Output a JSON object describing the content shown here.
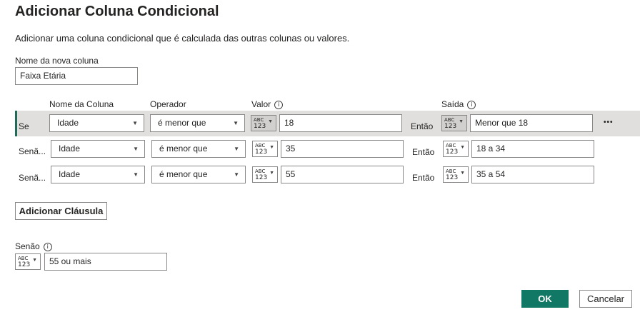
{
  "dialog": {
    "title": "Adicionar Coluna Condicional",
    "description": "Adicionar uma coluna condicional que é calculada das outras colunas ou valores."
  },
  "new_column": {
    "label": "Nome da nova coluna",
    "value": "Faixa Etária"
  },
  "headers": {
    "column_name": "Nome da Coluna",
    "operator": "Operador",
    "value": "Valor",
    "output": "Saída",
    "info_glyph": "i"
  },
  "type_selector": {
    "top": "ABC",
    "bottom": "123",
    "chevron": "▼"
  },
  "rules": [
    {
      "prefix": "Se",
      "column": "Idade",
      "operator": "é menor que",
      "value": "18",
      "then": "Então",
      "output": "Menor que 18"
    },
    {
      "prefix": "Senã...",
      "column": "Idade",
      "operator": "é menor que",
      "value": "35",
      "then": "Então",
      "output": "18 a 34"
    },
    {
      "prefix": "Senã...",
      "column": "Idade",
      "operator": "é menor que",
      "value": "55",
      "then": "Então",
      "output": "35 a 54"
    }
  ],
  "more_glyph": "•••",
  "add_clause_label": "Adicionar Cláusula",
  "else": {
    "label": "Senão",
    "value": "55 ou mais"
  },
  "footer": {
    "ok_label": "OK",
    "cancel_label": "Cancelar"
  },
  "colors": {
    "accent": "#117865",
    "selected_row": "#e1dfdd",
    "row_indicator": "#1f6b57"
  }
}
